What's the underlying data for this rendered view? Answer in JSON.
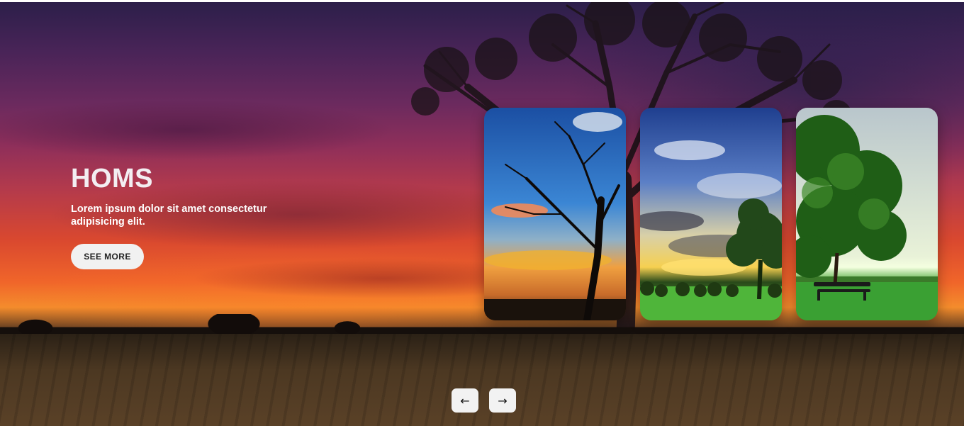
{
  "slide": {
    "title": "HOMS",
    "description": "Lorem ipsum dolor sit amet consectetur adipisicing elit.",
    "button_label": "SEE MORE"
  },
  "thumbnails": [
    {
      "name": "sunset-tree-silhouette"
    },
    {
      "name": "cloudy-sky-tree-field"
    },
    {
      "name": "green-tree-bench"
    }
  ],
  "controls": {
    "prev_icon": "arrow-left-icon",
    "next_icon": "arrow-right-icon",
    "prev_glyph": "←",
    "next_glyph": "→"
  }
}
